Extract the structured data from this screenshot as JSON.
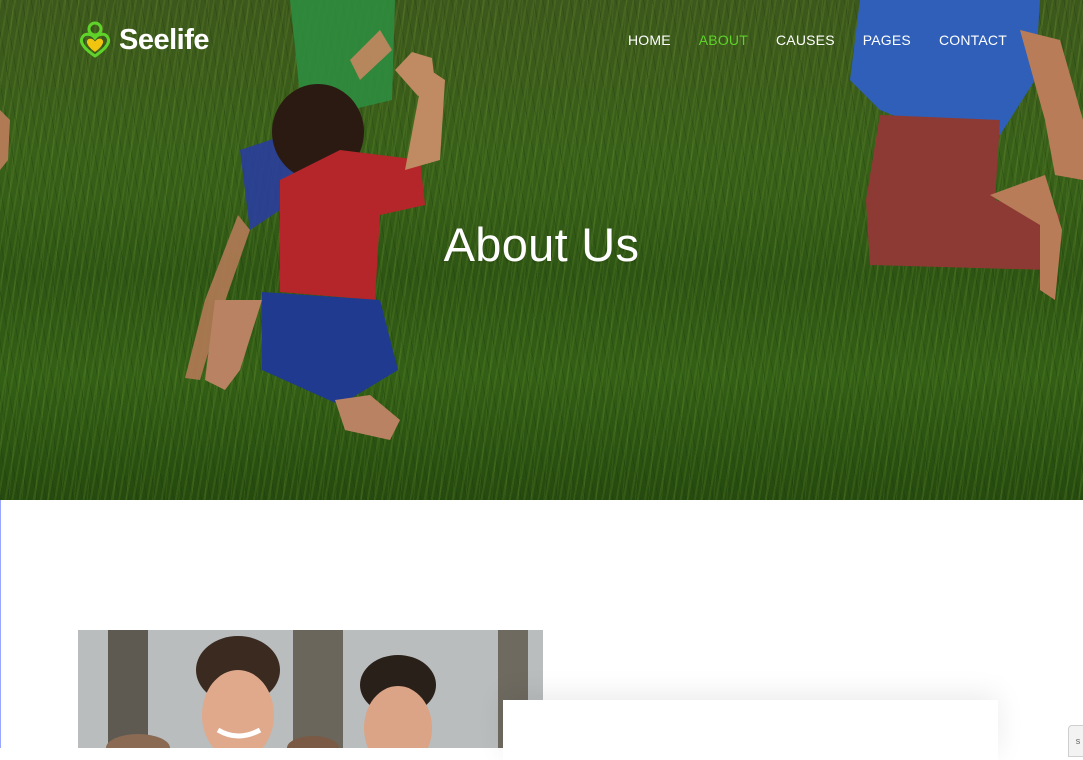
{
  "brand": {
    "name": "Seelife",
    "accent": "#5fd32a",
    "heart_color": "#f1c40f"
  },
  "nav": {
    "items": [
      {
        "label": "HOME",
        "active": false
      },
      {
        "label": "ABOUT",
        "active": true
      },
      {
        "label": "CAUSES",
        "active": false
      },
      {
        "label": "PAGES",
        "active": false
      },
      {
        "label": "CONTACT",
        "active": false
      }
    ]
  },
  "hero": {
    "title": "About Us"
  },
  "scroll_widget": {
    "glyph": "s"
  }
}
